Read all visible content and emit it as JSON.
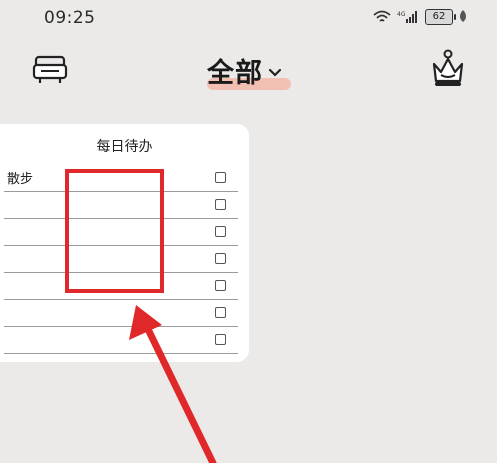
{
  "status_bar": {
    "time": "09:25",
    "network_label": "4G",
    "battery_level": "62",
    "icons": [
      "wifi-icon",
      "signal-icon",
      "battery-icon",
      "leaf-icon"
    ]
  },
  "header": {
    "title": "全部",
    "left_icon": "sofa-icon",
    "right_icon": "crown-icon"
  },
  "card": {
    "title": "每日待办",
    "rows": [
      {
        "label": "散步",
        "checked": false
      },
      {
        "label": "",
        "checked": false
      },
      {
        "label": "",
        "checked": false
      },
      {
        "label": "",
        "checked": false
      },
      {
        "label": "",
        "checked": false
      },
      {
        "label": "",
        "checked": false
      },
      {
        "label": "",
        "checked": false
      }
    ]
  },
  "annotation": {
    "color": "#e0282a"
  }
}
